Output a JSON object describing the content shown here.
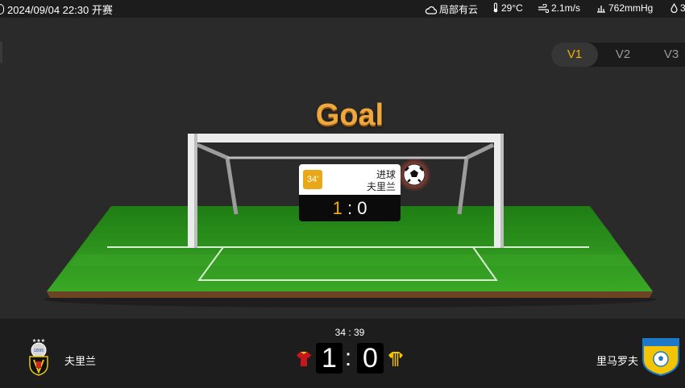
{
  "header": {
    "datetime": "2024/09/04 22:30 开赛",
    "weather": "局部有云",
    "temperature": "29°C",
    "wind": "2.1m/s",
    "pressure": "762mmHg",
    "humidity": "3"
  },
  "view_switch": {
    "options": [
      "V1",
      "V2",
      "V3"
    ],
    "active": "V1"
  },
  "animation": {
    "title": "Goal",
    "event": {
      "minute": "34'",
      "type": "进球",
      "team": "夫里兰",
      "score_home": "1",
      "separator": ":",
      "score_away": "0"
    }
  },
  "match": {
    "clock": "34 : 39",
    "home": {
      "name": "夫里兰",
      "score": "1",
      "kit_color": "#c8161d"
    },
    "away": {
      "name": "里马罗夫",
      "score": "0",
      "kit_color": "#f4c400"
    },
    "separator": ":"
  },
  "colors": {
    "accent": "#f0b100",
    "pitch": "#2e9a1d"
  }
}
